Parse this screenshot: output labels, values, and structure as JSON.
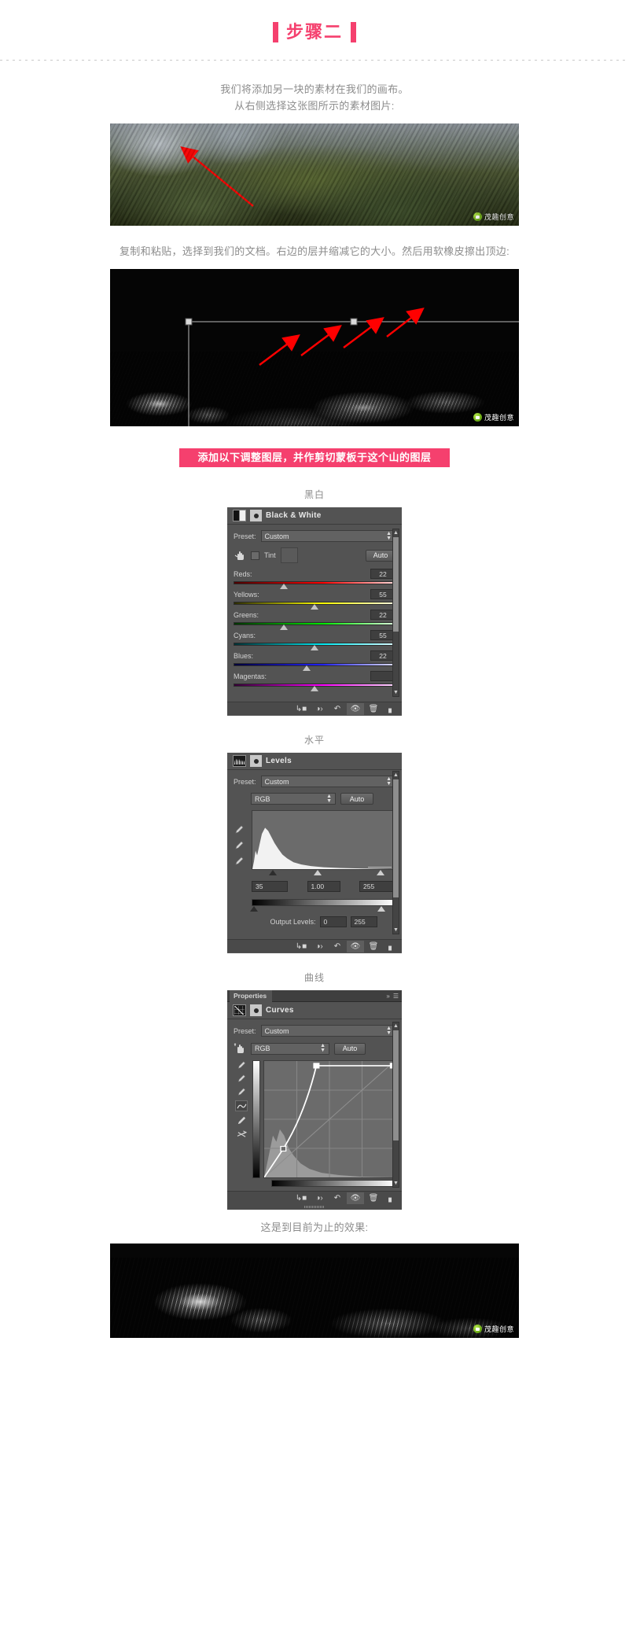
{
  "header": {
    "title": "步骤二",
    "bar_color": "#f5406e"
  },
  "intro": {
    "line1": "我们将添加另一块的素材在我们的画布。",
    "line2": "从右侧选择这张图所示的素材图片:"
  },
  "watermark": {
    "text": "茂趣创意",
    "logo_icon": "wechat-logo-icon"
  },
  "section2": {
    "caption": "复制和粘贴，选择到我们的文档。右边的层并缩减它的大小。然后用软橡皮擦出顶边:"
  },
  "pink_banner": {
    "text": "添加以下调整图层，并作剪切蒙板于这个山的图层",
    "bg": "#f5406e"
  },
  "panels": [
    {
      "section_label": "黑白",
      "tab": null,
      "title": "Black & White",
      "preset_label": "Preset:",
      "preset_value": "Custom",
      "tint_label": "Tint",
      "auto_label": "Auto",
      "sliders": [
        {
          "name": "Reds:",
          "value": "22",
          "pos": 31,
          "from": "#4a0000",
          "mid": "#ff0000",
          "to": "#ffd9d9"
        },
        {
          "name": "Yellows:",
          "value": "55",
          "pos": 50,
          "from": "#2b2b00",
          "mid": "#ffff00",
          "to": "#ffffe0"
        },
        {
          "name": "Greens:",
          "value": "22",
          "pos": 31,
          "from": "#003200",
          "mid": "#00e800",
          "to": "#dcffdc"
        },
        {
          "name": "Cyans:",
          "value": "55",
          "pos": 50,
          "from": "#002f33",
          "mid": "#00e8f0",
          "to": "#dcfbff"
        },
        {
          "name": "Blues:",
          "value": "22",
          "pos": 45,
          "from": "#000038",
          "mid": "#2020ff",
          "to": "#dcdcff"
        },
        {
          "name": "Magentas:",
          "value": "",
          "pos": 50,
          "from": "#330033",
          "mid": "#ff00ff",
          "to": "#ffdcff"
        }
      ]
    },
    {
      "section_label": "水平",
      "tab": null,
      "title": "Levels",
      "preset_label": "Preset:",
      "preset_value": "Custom",
      "channel_value": "RGB",
      "auto_label": "Auto",
      "input_black": "35",
      "input_gamma": "1.00",
      "input_white": "255",
      "output_label": "Output Levels:",
      "output_black": "0",
      "output_white": "255"
    },
    {
      "section_label": "曲线",
      "tab": "Properties",
      "title": "Curves",
      "preset_label": "Preset:",
      "preset_value": "Custom",
      "channel_value": "RGB",
      "auto_label": "Auto"
    }
  ],
  "footer_buttons": [
    {
      "name": "clip-to-layer-button",
      "glyph": "⊾"
    },
    {
      "name": "toggle-preview-button",
      "glyph": "◉"
    },
    {
      "name": "reset-button",
      "glyph": "↺"
    },
    {
      "name": "visibility-eye-button",
      "glyph": "👁"
    },
    {
      "name": "delete-layer-button",
      "glyph": "🗑"
    }
  ],
  "final": {
    "caption": "这是到目前为止的效果:"
  }
}
